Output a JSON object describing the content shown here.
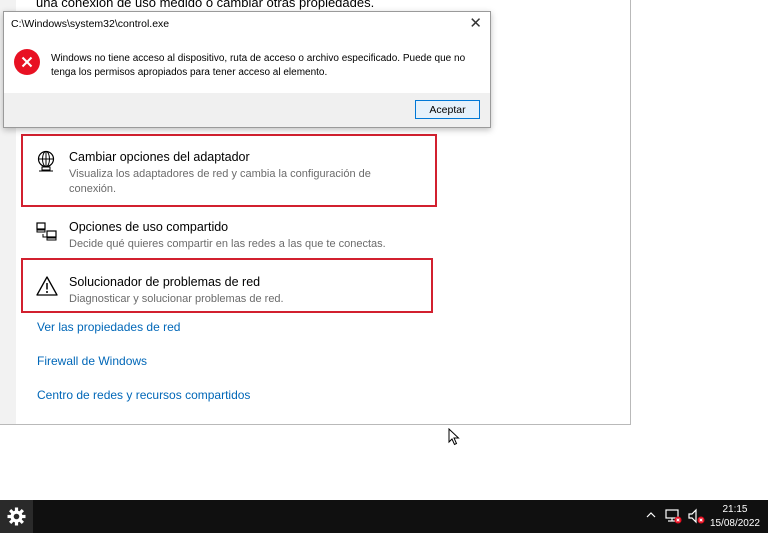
{
  "window": {
    "partial_text": "una conexión de uso medido o cambiar otras propiedades.",
    "options": [
      {
        "title": "Cambiar opciones del adaptador",
        "desc": "Visualiza los adaptadores de red y cambia la configuración de conexión.",
        "icon": "globe-network-icon"
      },
      {
        "title": "Opciones de uso compartido",
        "desc": "Decide qué quieres compartir en las redes a las que te conectas.",
        "icon": "sharing-icon"
      },
      {
        "title": "Solucionador de problemas de red",
        "desc": "Diagnosticar y solucionar problemas de red.",
        "icon": "warning-icon"
      }
    ],
    "links": [
      "Ver las propiedades de red",
      "Firewall de Windows",
      "Centro de redes y recursos compartidos"
    ]
  },
  "dialog": {
    "title": "C:\\Windows\\system32\\control.exe",
    "message": "Windows no tiene acceso al dispositivo, ruta de acceso o archivo especificado. Puede que no tenga los permisos apropiados para tener acceso al elemento.",
    "ok_label": "Aceptar",
    "close_glyph": "✕"
  },
  "taskbar": {
    "time": "21:15",
    "date": "15/08/2022"
  },
  "colors": {
    "highlight_box": "#d2202f",
    "link": "#0067b8",
    "error": "#e81123"
  }
}
